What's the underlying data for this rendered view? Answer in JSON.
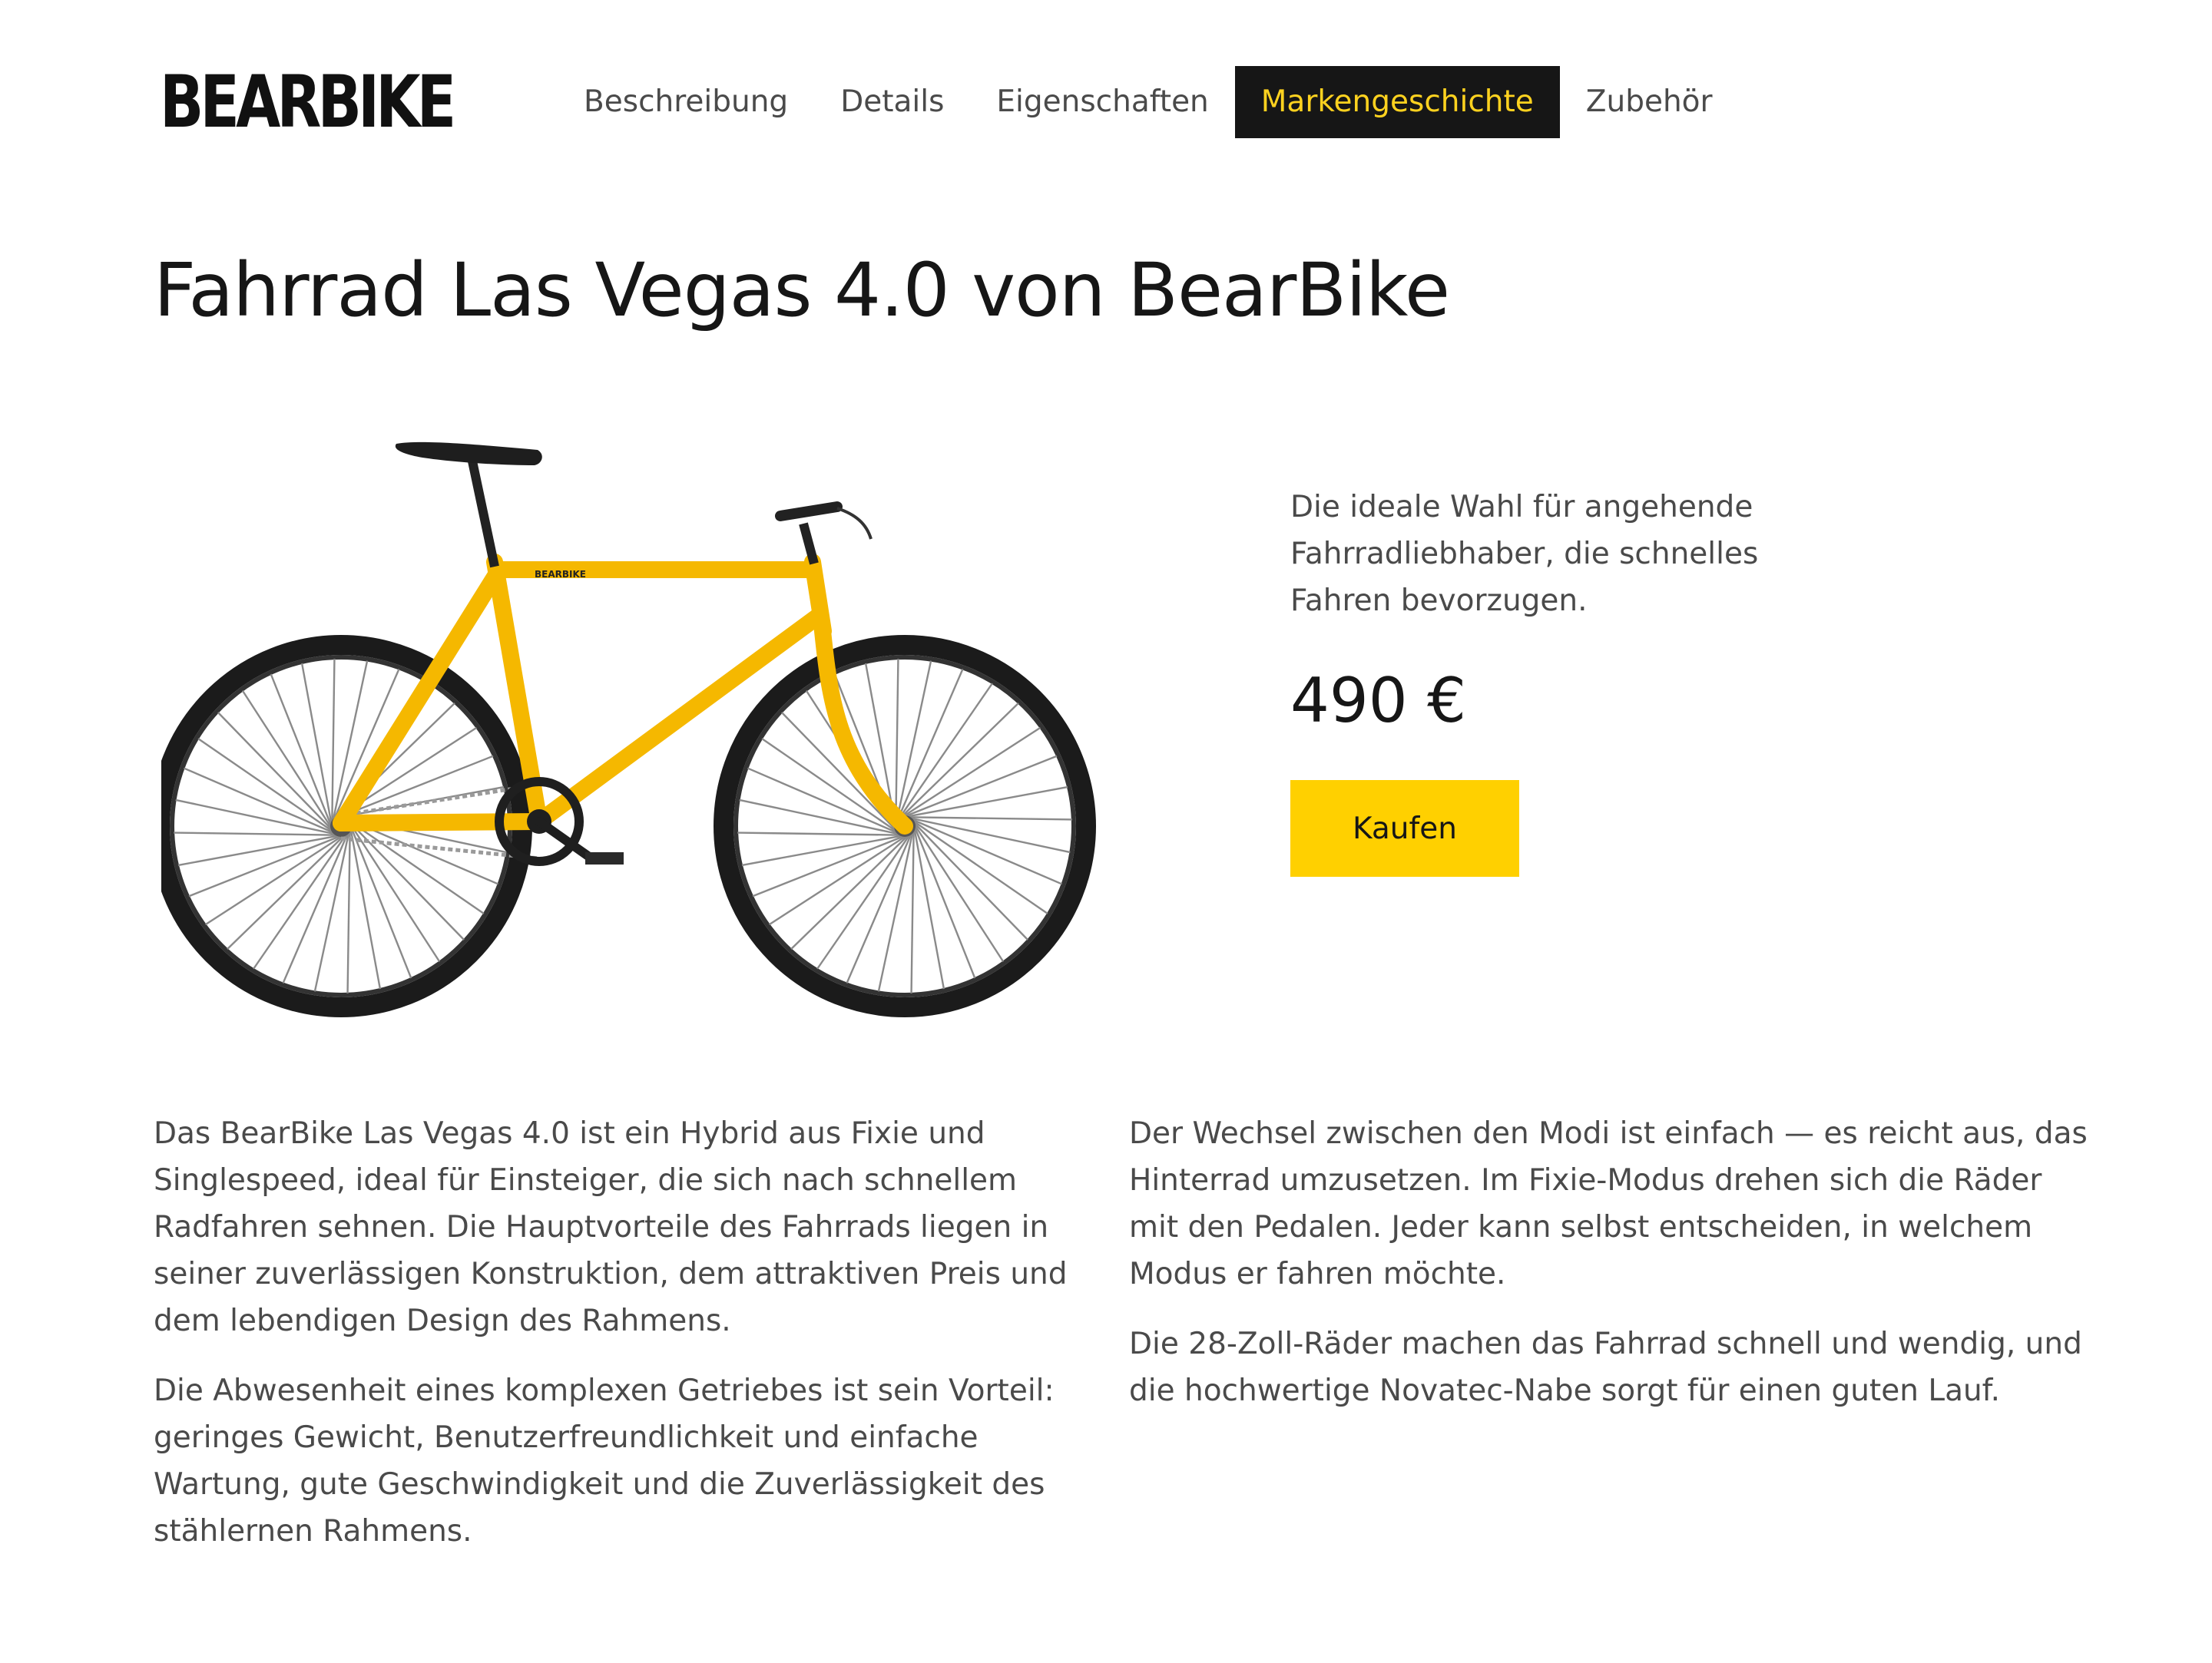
{
  "brand": {
    "name": "BEARBIKE",
    "logo_icon": "bear-paw-icon"
  },
  "nav": {
    "items": [
      {
        "label": "Beschreibung",
        "active": false
      },
      {
        "label": "Details",
        "active": false
      },
      {
        "label": "Eigenschaften",
        "active": false
      },
      {
        "label": "Markengeschichte",
        "active": true
      },
      {
        "label": "Zubehör",
        "active": false
      }
    ]
  },
  "product": {
    "title": "Fahrrad Las Vegas 4.0 von BearBike",
    "image": {
      "icon": "bicycle-illustration",
      "frame_color": "#f5b800",
      "frame_brand": "BEARBIKE"
    },
    "tagline": "Die ideale Wahl für angehende Fahrradliebhaber, die schnelles Fahren bevorzugen.",
    "price": "490 €",
    "buy_label": "Kaufen"
  },
  "description": {
    "left": [
      "Das BearBike Las Vegas 4.0 ist ein Hybrid aus Fixie und Singlespeed, ideal für Einsteiger, die sich nach schnellem Radfahren sehnen. Die Hauptvorteile des Fahrrads liegen in seiner zuverlässigen Konstruktion, dem attraktiven Preis und dem lebendigen Design des Rahmens.",
      "Die Abwesenheit eines komplexen Getriebes ist sein Vorteil: geringes Gewicht, Benutzerfreundlichkeit und einfache Wartung, gute Geschwindigkeit und die Zuverlässigkeit des stählernen Rahmens."
    ],
    "right": [
      "Der Wechsel zwischen den Modi ist einfach — es reicht aus, das Hinterrad umzusetzen. Im Fixie-Modus drehen sich die Räder mit den Pedalen. Jeder kann selbst entscheiden, in welchem Modus er fahren möchte.",
      "Die 28-Zoll-Räder machen das Fahrrad schnell und wendig, und die hochwertige Novatec-Nabe sorgt für einen guten Lauf."
    ]
  },
  "colors": {
    "accent": "#ffd000",
    "nav_active_bg": "#161616",
    "nav_active_text": "#ffd21f",
    "text": "#4a4a4a",
    "heading": "#161616"
  }
}
